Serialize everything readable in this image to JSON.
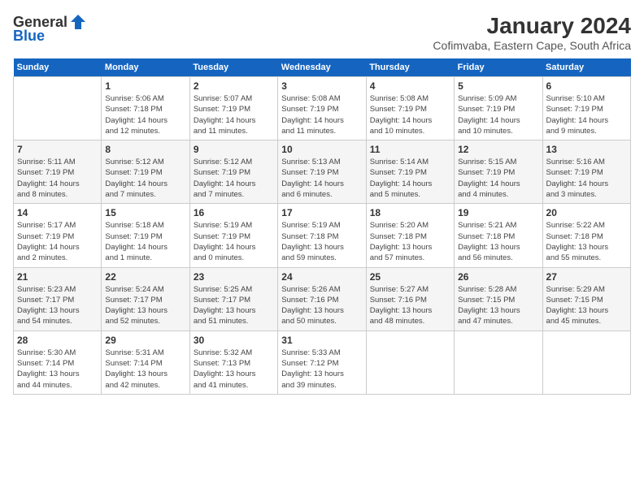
{
  "logo": {
    "line1": "General",
    "line2": "Blue"
  },
  "title": "January 2024",
  "subtitle": "Cofimvaba, Eastern Cape, South Africa",
  "weekdays": [
    "Sunday",
    "Monday",
    "Tuesday",
    "Wednesday",
    "Thursday",
    "Friday",
    "Saturday"
  ],
  "weeks": [
    [
      {
        "num": "",
        "info": ""
      },
      {
        "num": "1",
        "info": "Sunrise: 5:06 AM\nSunset: 7:18 PM\nDaylight: 14 hours\nand 12 minutes."
      },
      {
        "num": "2",
        "info": "Sunrise: 5:07 AM\nSunset: 7:19 PM\nDaylight: 14 hours\nand 11 minutes."
      },
      {
        "num": "3",
        "info": "Sunrise: 5:08 AM\nSunset: 7:19 PM\nDaylight: 14 hours\nand 11 minutes."
      },
      {
        "num": "4",
        "info": "Sunrise: 5:08 AM\nSunset: 7:19 PM\nDaylight: 14 hours\nand 10 minutes."
      },
      {
        "num": "5",
        "info": "Sunrise: 5:09 AM\nSunset: 7:19 PM\nDaylight: 14 hours\nand 10 minutes."
      },
      {
        "num": "6",
        "info": "Sunrise: 5:10 AM\nSunset: 7:19 PM\nDaylight: 14 hours\nand 9 minutes."
      }
    ],
    [
      {
        "num": "7",
        "info": "Sunrise: 5:11 AM\nSunset: 7:19 PM\nDaylight: 14 hours\nand 8 minutes."
      },
      {
        "num": "8",
        "info": "Sunrise: 5:12 AM\nSunset: 7:19 PM\nDaylight: 14 hours\nand 7 minutes."
      },
      {
        "num": "9",
        "info": "Sunrise: 5:12 AM\nSunset: 7:19 PM\nDaylight: 14 hours\nand 7 minutes."
      },
      {
        "num": "10",
        "info": "Sunrise: 5:13 AM\nSunset: 7:19 PM\nDaylight: 14 hours\nand 6 minutes."
      },
      {
        "num": "11",
        "info": "Sunrise: 5:14 AM\nSunset: 7:19 PM\nDaylight: 14 hours\nand 5 minutes."
      },
      {
        "num": "12",
        "info": "Sunrise: 5:15 AM\nSunset: 7:19 PM\nDaylight: 14 hours\nand 4 minutes."
      },
      {
        "num": "13",
        "info": "Sunrise: 5:16 AM\nSunset: 7:19 PM\nDaylight: 14 hours\nand 3 minutes."
      }
    ],
    [
      {
        "num": "14",
        "info": "Sunrise: 5:17 AM\nSunset: 7:19 PM\nDaylight: 14 hours\nand 2 minutes."
      },
      {
        "num": "15",
        "info": "Sunrise: 5:18 AM\nSunset: 7:19 PM\nDaylight: 14 hours\nand 1 minute."
      },
      {
        "num": "16",
        "info": "Sunrise: 5:19 AM\nSunset: 7:19 PM\nDaylight: 14 hours\nand 0 minutes."
      },
      {
        "num": "17",
        "info": "Sunrise: 5:19 AM\nSunset: 7:18 PM\nDaylight: 13 hours\nand 59 minutes."
      },
      {
        "num": "18",
        "info": "Sunrise: 5:20 AM\nSunset: 7:18 PM\nDaylight: 13 hours\nand 57 minutes."
      },
      {
        "num": "19",
        "info": "Sunrise: 5:21 AM\nSunset: 7:18 PM\nDaylight: 13 hours\nand 56 minutes."
      },
      {
        "num": "20",
        "info": "Sunrise: 5:22 AM\nSunset: 7:18 PM\nDaylight: 13 hours\nand 55 minutes."
      }
    ],
    [
      {
        "num": "21",
        "info": "Sunrise: 5:23 AM\nSunset: 7:17 PM\nDaylight: 13 hours\nand 54 minutes."
      },
      {
        "num": "22",
        "info": "Sunrise: 5:24 AM\nSunset: 7:17 PM\nDaylight: 13 hours\nand 52 minutes."
      },
      {
        "num": "23",
        "info": "Sunrise: 5:25 AM\nSunset: 7:17 PM\nDaylight: 13 hours\nand 51 minutes."
      },
      {
        "num": "24",
        "info": "Sunrise: 5:26 AM\nSunset: 7:16 PM\nDaylight: 13 hours\nand 50 minutes."
      },
      {
        "num": "25",
        "info": "Sunrise: 5:27 AM\nSunset: 7:16 PM\nDaylight: 13 hours\nand 48 minutes."
      },
      {
        "num": "26",
        "info": "Sunrise: 5:28 AM\nSunset: 7:15 PM\nDaylight: 13 hours\nand 47 minutes."
      },
      {
        "num": "27",
        "info": "Sunrise: 5:29 AM\nSunset: 7:15 PM\nDaylight: 13 hours\nand 45 minutes."
      }
    ],
    [
      {
        "num": "28",
        "info": "Sunrise: 5:30 AM\nSunset: 7:14 PM\nDaylight: 13 hours\nand 44 minutes."
      },
      {
        "num": "29",
        "info": "Sunrise: 5:31 AM\nSunset: 7:14 PM\nDaylight: 13 hours\nand 42 minutes."
      },
      {
        "num": "30",
        "info": "Sunrise: 5:32 AM\nSunset: 7:13 PM\nDaylight: 13 hours\nand 41 minutes."
      },
      {
        "num": "31",
        "info": "Sunrise: 5:33 AM\nSunset: 7:12 PM\nDaylight: 13 hours\nand 39 minutes."
      },
      {
        "num": "",
        "info": ""
      },
      {
        "num": "",
        "info": ""
      },
      {
        "num": "",
        "info": ""
      }
    ]
  ]
}
